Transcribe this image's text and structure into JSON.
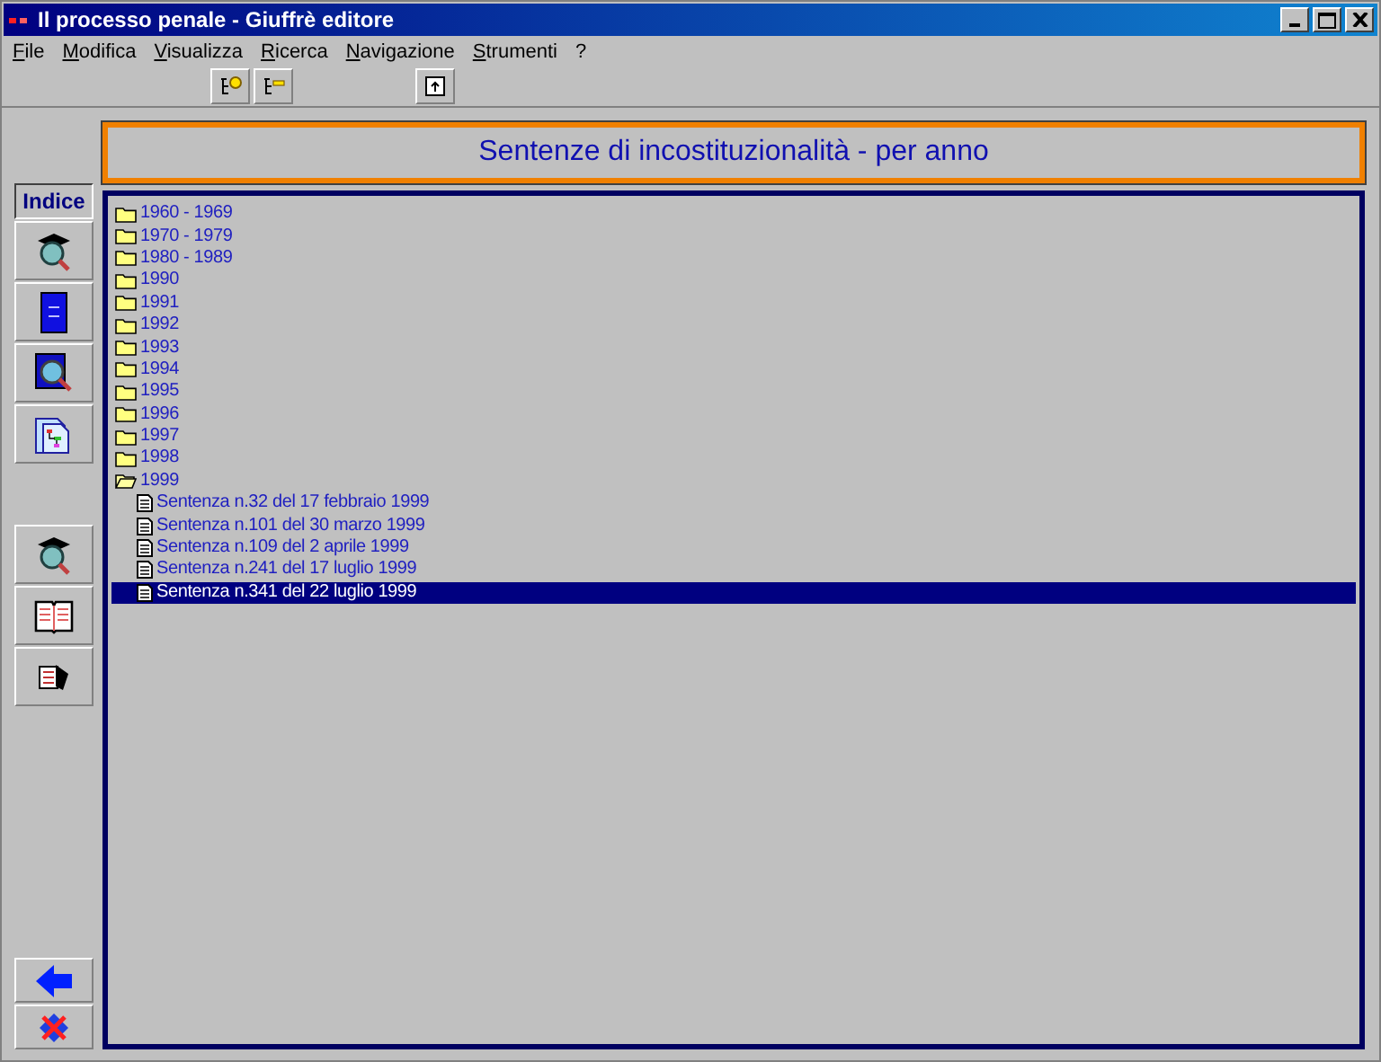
{
  "window": {
    "title": "Il processo penale - Giuffrè editore"
  },
  "menu": [
    "File",
    "Modifica",
    "Visualizza",
    "Ricerca",
    "Navigazione",
    "Strumenti",
    "?"
  ],
  "toolbar": [
    {
      "kind": "expand"
    },
    {
      "kind": "collapse"
    },
    {
      "kind": "gap"
    },
    {
      "kind": "up"
    }
  ],
  "sidebar": [
    {
      "kind": "text",
      "label": "Indice"
    },
    {
      "kind": "scholar"
    },
    {
      "kind": "book"
    },
    {
      "kind": "search"
    },
    {
      "kind": "tree"
    },
    {
      "kind": "gap"
    },
    {
      "kind": "scholar"
    },
    {
      "kind": "open-book"
    },
    {
      "kind": "copy"
    },
    {
      "kind": "spacer"
    },
    {
      "kind": "back"
    },
    {
      "kind": "cancel"
    }
  ],
  "header": {
    "title": "Sentenze di incostituzionalità - per anno"
  },
  "tree": [
    {
      "label": "1960 - 1969",
      "expanded": false,
      "selected": false
    },
    {
      "label": "1970 - 1979",
      "expanded": false,
      "selected": false
    },
    {
      "label": "1980 - 1989",
      "expanded": false,
      "selected": false
    },
    {
      "label": "1990",
      "expanded": false,
      "selected": false
    },
    {
      "label": "1991",
      "expanded": false,
      "selected": false
    },
    {
      "label": "1992",
      "expanded": false,
      "selected": false
    },
    {
      "label": "1993",
      "expanded": false,
      "selected": false
    },
    {
      "label": "1994",
      "expanded": false,
      "selected": false
    },
    {
      "label": "1995",
      "expanded": false,
      "selected": false
    },
    {
      "label": "1996",
      "expanded": false,
      "selected": false
    },
    {
      "label": "1997",
      "expanded": false,
      "selected": false
    },
    {
      "label": "1998",
      "expanded": false,
      "selected": false
    },
    {
      "label": "1999",
      "expanded": true,
      "selected": false,
      "children": [
        {
          "label": "Sentenza n.32 del 17 febbraio 1999",
          "selected": false
        },
        {
          "label": "Sentenza n.101 del 30 marzo 1999",
          "selected": false
        },
        {
          "label": "Sentenza n.109 del 2 aprile 1999",
          "selected": false
        },
        {
          "label": "Sentenza n.241 del 17 luglio 1999",
          "selected": false
        },
        {
          "label": "Sentenza n.341 del 22 luglio 1999",
          "selected": true
        }
      ]
    }
  ]
}
